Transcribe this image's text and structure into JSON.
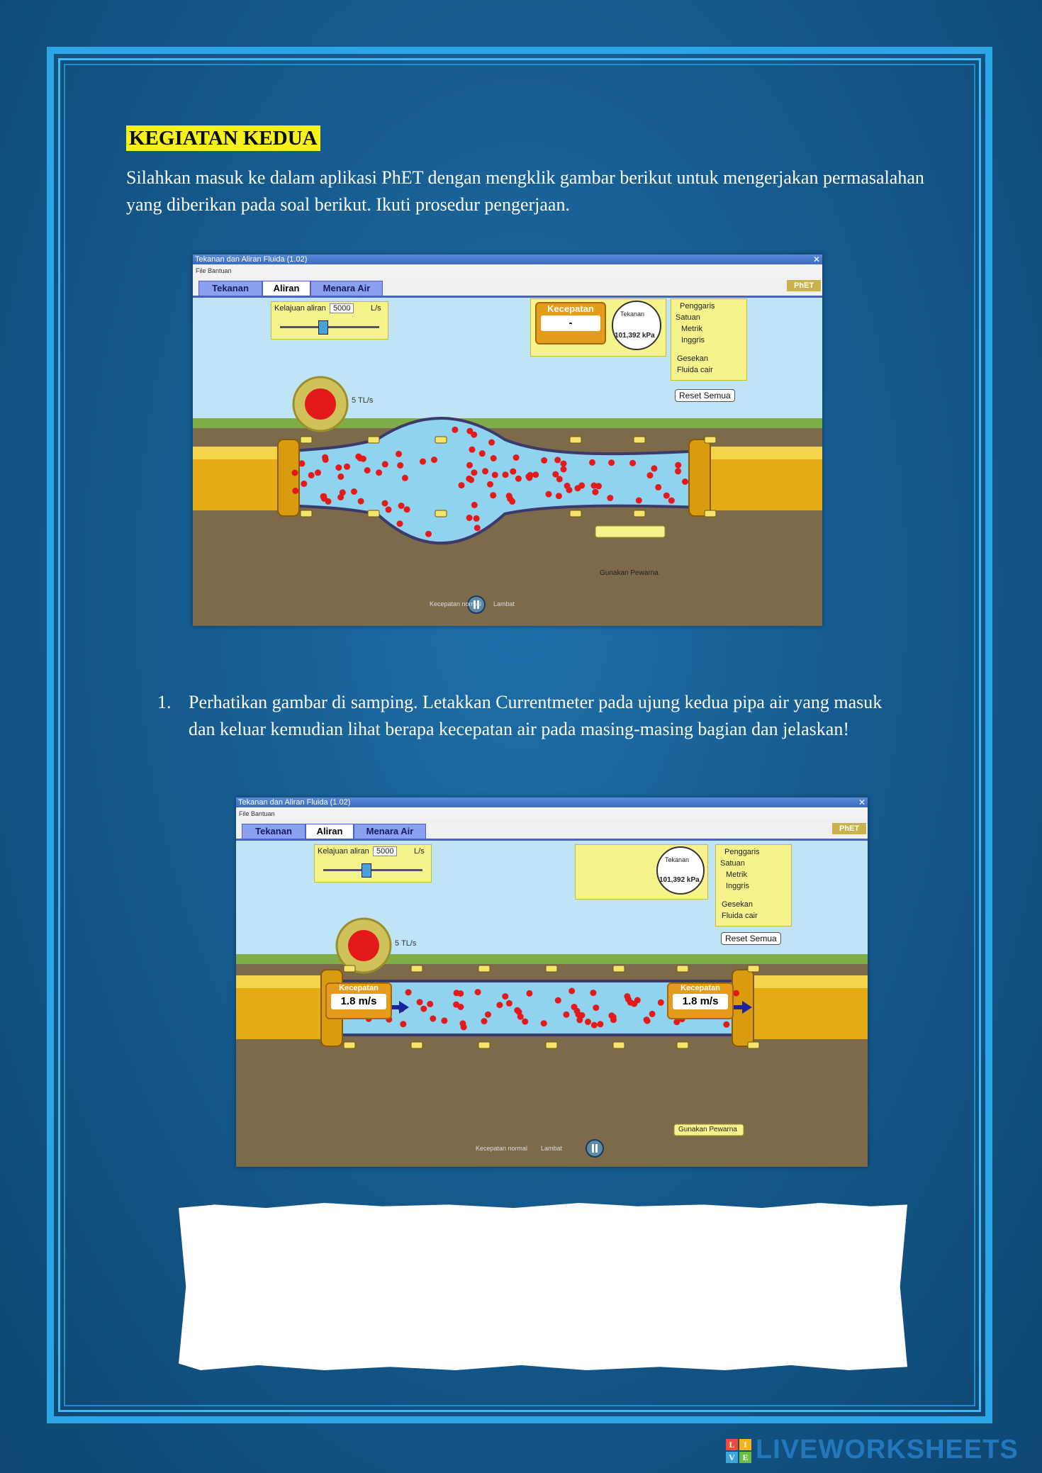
{
  "title": "KEGIATAN KEDUA",
  "intro": "Silahkan masuk ke dalam aplikasi PhET dengan mengklik gambar berikut untuk mengerjakan permasalahan yang diberikan pada soal berikut. Ikuti prosedur pengerjaan.",
  "question": {
    "number": "1.",
    "text": "Perhatikan gambar di samping. Letakkan Currentmeter pada ujung kedua pipa air yang masuk dan keluar kemudian lihat berapa kecepatan air pada masing-masing bagian dan jelaskan!"
  },
  "sim1": {
    "window_title": "Tekanan dan Aliran Fluida (1.02)",
    "menu": "File   Bantuan",
    "tabs": [
      "Tekanan",
      "Aliran",
      "Menara Air"
    ],
    "logo": "PhET",
    "flow_label": "Kelajuan aliran",
    "flow_value": "5000",
    "flow_unit": "L/s",
    "speed_meter_label": "Kecepatan",
    "speed_meter_value": "-",
    "pressure_readout": "101,392 kPa",
    "gauge_label": "Tekanan",
    "options": [
      "Penggaris",
      "Satuan",
      "Metrik",
      "Inggris",
      "Gesekan",
      "Fluida cair"
    ],
    "reset_label": "Reset Semua",
    "rate_label": "5 TL/s",
    "dots_label": "Gunakan Pewarna",
    "bottom_controls": [
      "Kecepatan normal",
      "Lambat"
    ]
  },
  "sim2": {
    "window_title": "Tekanan dan Aliran Fluida (1.02)",
    "menu": "File   Bantuan",
    "tabs": [
      "Tekanan",
      "Aliran",
      "Menara Air"
    ],
    "logo": "PhET",
    "flow_label": "Kelajuan aliran",
    "flow_value": "5000",
    "flow_unit": "L/s",
    "pressure_readout": "101,392 kPa",
    "gauge_label": "Tekanan",
    "options": [
      "Penggaris",
      "Satuan",
      "Metrik",
      "Inggris",
      "Gesekan",
      "Fluida cair"
    ],
    "reset_label": "Reset Semua",
    "rate_label": "5 TL/s",
    "meter_left_label": "Kecepatan",
    "meter_left_value": "1.8 m/s",
    "meter_right_label": "Kecepatan",
    "meter_right_value": "1.8 m/s",
    "dots_label": "Gunakan Pewarna",
    "bottom_controls": [
      "Kecepatan normal",
      "Lambat"
    ]
  },
  "watermark": "LIVEWORKSHEETS",
  "watermark_logo": [
    "L",
    "I",
    "V",
    "E"
  ],
  "colors": {
    "page_bg": "#14578a",
    "frame": "#2aa6e6",
    "title_highlight": "#f4f11c",
    "water": "#8fd3ee",
    "pipe": "#e3ab14",
    "particles": "#e41a1a"
  }
}
